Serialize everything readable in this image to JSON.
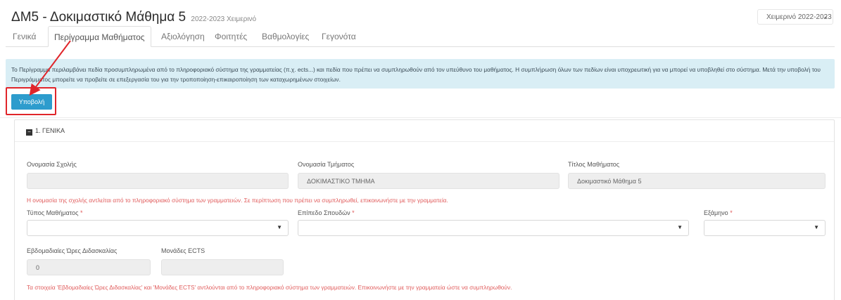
{
  "header": {
    "course_title": "ΔΜ5 - Δοκιμαστικό Μάθημα 5",
    "course_subtitle": "2022-2023 Χειμερινό",
    "semester_selector": "Χειμερινό 2022-2023"
  },
  "tabs": [
    {
      "label": "Γενικά"
    },
    {
      "label": "Περίγραμμα Μαθήματος",
      "active": true
    },
    {
      "label": "Αξιολόγηση"
    },
    {
      "label": "Φοιτητές"
    },
    {
      "label": "Βαθμολογίες"
    },
    {
      "label": "Γεγονότα"
    }
  ],
  "info": {
    "text": "Το Περίγραμμα περιλαμβάνει πεδία προσυμπληρωμένα από το πληροφοριακό σύστημα της γραμματείας (π.χ. ects...) και πεδία που πρέπει να συμπληρωθούν από τον υπεύθυνο του μαθήματος. Η συμπλήρωση όλων των πεδίων είναι υποχρεωτική για να μπορεί να υποβληθεί στο σύστημα. Μετά την υποβολή του Περιγράμματος μπορείτε να προβείτε σε επεξεργασία του για την τροποποίηση-επικαιροποίηση των καταχωρημένων στοιχείων."
  },
  "actions": {
    "submit_label": "Υποβολή"
  },
  "section": {
    "title": "1. ΓΕΝΙΚΑ",
    "school_label": "Ονομασία Σχολής",
    "school_value": "",
    "department_label": "Ονομασία Τμήματος",
    "department_value": "ΔΟΚΙΜΑΣΤΙΚΟ ΤΜΗΜΑ",
    "course_label": "Τίτλος Μαθήματος",
    "course_value": "Δοκιμαστικό Μάθημα 5",
    "school_warning": "Η ονομασία της σχολής αντλείται από το πληροφοριακό σύστημα των γραμματειών. Σε περίπτωση που πρέπει να συμπληρωθεί, επικοινωνήστε με την γραμματεία.",
    "course_type_label": "Τύπος Μαθήματος",
    "study_level_label": "Επίπεδο Σπουδών",
    "semester_label": "Εξάμηνο",
    "required_mark": "*",
    "weekly_hours_label": "Εβδομαδιαίες Ώρες Διδασκαλίας",
    "weekly_hours_value": "0",
    "ects_label": "Μονάδες ECTS",
    "ects_value": "",
    "hours_warning": "Τα στοιχεία 'Εβδομαδιαίες Ώρες Διδασκαλίας' και 'Μονάδες ECTS' αντλούνται από το πληροφοριακό σύστημα των γραμματειών. Επικοινωνήστε με την γραμματεία ώστε να συμπληρωθούν."
  },
  "icons": {
    "collapse": "minus-square-icon",
    "dropdown": "caret-down-icon",
    "chevron": "chevron-down-icon"
  },
  "colors": {
    "accent": "#2d9ccd",
    "info_bg": "#d9eef5",
    "warning_text": "#e05a5a",
    "annotation": "#e0252a"
  }
}
